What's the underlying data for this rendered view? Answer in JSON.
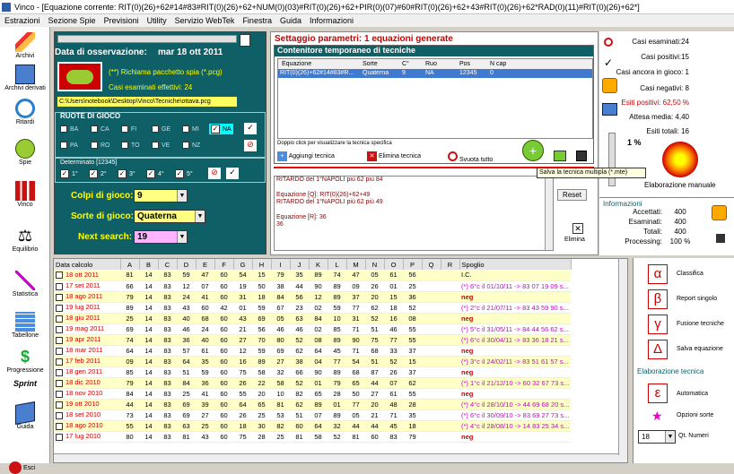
{
  "window": {
    "title": "Vinco - [Equazione corrente: RIT(0)(26)+62#14#83#RIT(0)(26)+62+NUM(0)(03)#RIT(0)(26)+62+PIR(0)(07)#60#RIT(0)(26)+62+43#RIT(0)(26)+62*RAD(0)(11)#RIT(0)(26)+62*]"
  },
  "menu": [
    "Estrazioni",
    "Sezione Spie",
    "Previsioni",
    "Utility",
    "Servizio WebTek",
    "Finestra",
    "Guida",
    "Informazioni"
  ],
  "sidebar": [
    "Archivi",
    "Archivi derivati",
    "Ritardi",
    "Spie",
    "Vinco",
    "Equilibrio",
    "Statistica",
    "Tabellone",
    "Progressione",
    "Sprint",
    "Guida",
    "Esci"
  ],
  "left": {
    "date_label": "Data di osservazione:",
    "date_value": "mar 18 ott 2011",
    "spy_text": "(**) Richiama pacchetto spia (*.pcg)",
    "casi_text": "Casi esaminati effettivi: 24",
    "path": "C:\\Users\\notebook\\Desktop\\Vinco\\Tecniche\\ottava.pcg",
    "ruote_title": "RUOTE DI GIOCO",
    "ruote1": [
      "BA",
      "CA",
      "FI",
      "GE",
      "MI",
      "NA"
    ],
    "ruote2": [
      "PA",
      "RO",
      "TO",
      "VE",
      "NZ"
    ],
    "determinato": "Determinato [12345]",
    "det_items": [
      "1°",
      "2°",
      "3°",
      "4°",
      "5°"
    ],
    "colpi_label": "Colpi di gioco:",
    "colpi_value": "9",
    "sorte_label": "Sorte di gioco:",
    "sorte_value": "Quaterna",
    "next_label": "Next search:",
    "next_value": "19"
  },
  "mid": {
    "title": "Settaggio parametri: 1 equazioni generate",
    "cont_title": "Contenitore temporaneo di tecniche",
    "cols": [
      "Equazione",
      "Sorte",
      "C°",
      "Ruo",
      "Pos",
      "N cap"
    ],
    "row": [
      "RIT(0)(26)+62#14#83#R...",
      "Quaterna",
      "9",
      "NA",
      "12345",
      "0"
    ],
    "hint": "Doppio click per visualizzare la tecnica specifica",
    "add": "Aggiungi tecnica",
    "del": "Elimina tecnica",
    "empty": "Svuota tutto",
    "tooltip": "Salva la tecnica multipla (*.mte)",
    "text": [
      "RITARDO del 1°NAPOLI  più 62  più 84",
      "",
      "Equazione [Q]: RIT(0)(26)+62+49",
      "RITARDO del 1°NAPOLI  più 62  più 49",
      "",
      "Equazione [R]: 36",
      "36"
    ],
    "reset": "Reset",
    "elimina": "Elimina"
  },
  "right": {
    "stats": [
      "Casi esaminati:24",
      "Casi positivi:15",
      "Casi ancora in gioco: 1",
      "Casi negativi: 8",
      "Esiti positivi: 62,50 %",
      "Attesa media: 4,40",
      "Esiti totali: 16"
    ],
    "pct": "1 %",
    "elab": "Elaborazione manuale",
    "info_title": "Informazioni",
    "info": [
      [
        "Accettati:",
        "400"
      ],
      [
        "Esaminati:",
        "400"
      ],
      [
        "Totali:",
        "400"
      ],
      [
        "Processing:",
        "100 %"
      ]
    ]
  },
  "grid": {
    "headers": [
      "Data calcolo",
      "A",
      "B",
      "C",
      "D",
      "E",
      "F",
      "G",
      "H",
      "I",
      "J",
      "K",
      "L",
      "M",
      "N",
      "O",
      "P",
      "Q",
      "R",
      "Spoglio"
    ],
    "rows": [
      [
        "18 ott 2011",
        "81",
        "14",
        "83",
        "59",
        "47",
        "60",
        "54",
        "15",
        "79",
        "35",
        "89",
        "74",
        "47",
        "05",
        "61",
        "56",
        "I.C."
      ],
      [
        "17 set 2011",
        "66",
        "14",
        "83",
        "12",
        "07",
        "60",
        "19",
        "50",
        "38",
        "44",
        "90",
        "89",
        "09",
        "26",
        "01",
        "25",
        "(*) 6°c il 01/10/11 -> 83 07 19 09 s..."
      ],
      [
        "18 ago 2011",
        "79",
        "14",
        "83",
        "24",
        "41",
        "60",
        "31",
        "18",
        "84",
        "56",
        "12",
        "89",
        "37",
        "20",
        "15",
        "36",
        "neg"
      ],
      [
        "19 lug 2011",
        "89",
        "14",
        "83",
        "43",
        "60",
        "42",
        "01",
        "59",
        "67",
        "23",
        "02",
        "59",
        "77",
        "62",
        "18",
        "52",
        "(*) 2°c il 21/07/11 -> 83 43 59 90 s..."
      ],
      [
        "18 giu 2011",
        "25",
        "14",
        "83",
        "40",
        "68",
        "60",
        "43",
        "69",
        "05",
        "63",
        "84",
        "10",
        "31",
        "52",
        "16",
        "08",
        "neg"
      ],
      [
        "19 mag 2011",
        "69",
        "14",
        "83",
        "46",
        "24",
        "60",
        "21",
        "56",
        "46",
        "46",
        "02",
        "85",
        "71",
        "51",
        "46",
        "55",
        "(*) 5°c il 31/05/11 -> 84 44 56 62 s..."
      ],
      [
        "19 apr 2011",
        "74",
        "14",
        "83",
        "36",
        "40",
        "60",
        "27",
        "70",
        "80",
        "52",
        "08",
        "89",
        "90",
        "75",
        "77",
        "55",
        "(*) 6°c il 30/04/11 -> 83 36 18 21 s..."
      ],
      [
        "18 mar 2011",
        "64",
        "14",
        "83",
        "57",
        "61",
        "60",
        "12",
        "59",
        "69",
        "62",
        "64",
        "45",
        "71",
        "68",
        "33",
        "37",
        "neg"
      ],
      [
        "17 feb 2011",
        "09",
        "14",
        "83",
        "64",
        "35",
        "60",
        "16",
        "89",
        "27",
        "38",
        "04",
        "77",
        "54",
        "51",
        "52",
        "15",
        "(*) 3°c il 24/02/11 -> 83 51 61 57 s..."
      ],
      [
        "18 gen 2011",
        "85",
        "14",
        "83",
        "51",
        "59",
        "60",
        "75",
        "58",
        "32",
        "66",
        "90",
        "89",
        "68",
        "87",
        "26",
        "37",
        "neg"
      ],
      [
        "18 dic 2010",
        "79",
        "14",
        "83",
        "84",
        "36",
        "60",
        "26",
        "22",
        "58",
        "52",
        "01",
        "79",
        "65",
        "44",
        "07",
        "62",
        "(*) 1°c il 21/12/10 -> 60 32 67 73 s..."
      ],
      [
        "18 nov 2010",
        "84",
        "14",
        "83",
        "25",
        "41",
        "60",
        "55",
        "20",
        "10",
        "82",
        "65",
        "28",
        "50",
        "27",
        "61",
        "55",
        "neg"
      ],
      [
        "19 ott 2010",
        "44",
        "14",
        "83",
        "69",
        "39",
        "60",
        "64",
        "65",
        "81",
        "62",
        "89",
        "01",
        "77",
        "20",
        "48",
        "28",
        "(*) 4°c il 28/10/10 -> 44 69 68 20 s..."
      ],
      [
        "18 set 2010",
        "73",
        "14",
        "83",
        "69",
        "27",
        "60",
        "26",
        "25",
        "53",
        "51",
        "07",
        "89",
        "05",
        "21",
        "71",
        "35",
        "(*) 6°c il 30/09/10 -> 83 69 27 73 s..."
      ],
      [
        "18 ago 2010",
        "55",
        "14",
        "83",
        "63",
        "25",
        "60",
        "18",
        "30",
        "82",
        "60",
        "64",
        "32",
        "44",
        "44",
        "45",
        "18",
        "(*) 4°c il 28/08/10 -> 14 83 25 34 s..."
      ],
      [
        "17 lug 2010",
        "80",
        "14",
        "83",
        "81",
        "43",
        "60",
        "75",
        "28",
        "25",
        "81",
        "58",
        "52",
        "81",
        "60",
        "83",
        "79",
        "neg"
      ]
    ]
  },
  "bottom_right": {
    "items": [
      "Classifica",
      "Report singolo",
      "Fusione tecniche",
      "Salva equazione"
    ],
    "glyphs": [
      "α",
      "β",
      "γ",
      "Δ"
    ],
    "elab_title": "Elaborazione tecnica",
    "auto": "Automatica",
    "opz": "Opzioni sorte",
    "qt_value": "18",
    "qt_label": "Qt. Numeri"
  }
}
